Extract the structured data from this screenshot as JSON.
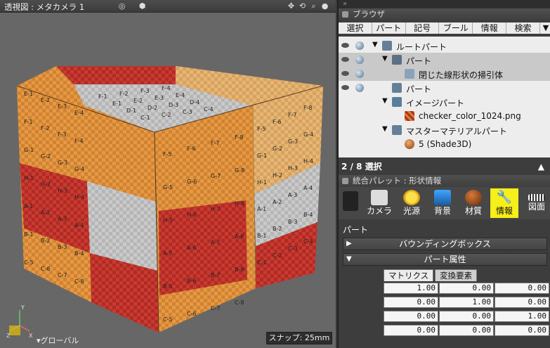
{
  "viewport": {
    "title": "透視図 : メタカメラ 1",
    "global_label": "グローバル",
    "snap_label": "スナップ: 25mm",
    "gizmo_labels": [
      "X",
      "Y",
      "Z"
    ]
  },
  "cube": {
    "top_labels": [
      "F-1",
      "F-2",
      "F-3",
      "F-4",
      "E-1",
      "E-2",
      "E-3",
      "E-4",
      "D-1",
      "D-2",
      "D-3",
      "D-4",
      "C-1",
      "C-2",
      "C-3",
      "C-4"
    ],
    "front_labels": [
      "F-5",
      "F-6",
      "F-7",
      "F-8",
      "G-5",
      "G-6",
      "G-7",
      "G-8",
      "H-5",
      "H-6",
      "H-7",
      "H-8",
      "A-5",
      "A-6",
      "A-7",
      "A-8",
      "B-5",
      "B-6",
      "B-7",
      "B-8",
      "C-5",
      "C-6",
      "C-7",
      "C-8"
    ],
    "right_labels": [
      "F-5",
      "F-6",
      "F-7",
      "F-8",
      "G-1",
      "G-2",
      "G-3",
      "G-4",
      "H-1",
      "H-2",
      "H-3",
      "H-4",
      "A-1",
      "A-2",
      "A-3",
      "A-4",
      "B-1",
      "B-2",
      "B-3",
      "B-4",
      "C-1",
      "C-2",
      "C-3",
      "C-4"
    ],
    "left_labels": [
      "E-1",
      "E-2",
      "E-3",
      "E-4",
      "F-1",
      "F-2",
      "F-3",
      "F-4",
      "G-1",
      "G-2",
      "G-3",
      "G-4",
      "H-1",
      "H-2",
      "H-3",
      "H-4",
      "A-1",
      "A-2",
      "A-3",
      "A-4",
      "B-1",
      "B-2",
      "B-3",
      "B-4",
      "C-5",
      "C-6",
      "C-7",
      "C-8"
    ],
    "colors": {
      "orange": "#d3822e",
      "red": "#b32a23",
      "gray": "#b8b8b8",
      "tan": "#d7a25e"
    }
  },
  "browser": {
    "header": "ブラウザ",
    "tabs": [
      "選択",
      "パート",
      "記号",
      "ブール",
      "情報",
      "検索",
      "▼"
    ],
    "tree": [
      {
        "label": "ルートパート",
        "icon": "part-icon"
      },
      {
        "label": "パート",
        "icon": "part-icon"
      },
      {
        "label": "閉じた線形状の掃引体",
        "icon": "sweep-icon"
      },
      {
        "label": "パート",
        "icon": "part-icon"
      },
      {
        "label": "イメージパート",
        "icon": "image-part-icon"
      },
      {
        "label": "checker_color_1024.png",
        "icon": "image-icon"
      },
      {
        "label": "マスターマテリアルパート",
        "icon": "material-part-icon"
      },
      {
        "label": "5 (Shade3D)",
        "icon": "material-icon"
      }
    ],
    "selection_count": "2 / 8 選択",
    "scroll_up": "▲"
  },
  "palette": {
    "header": "統合パレット : 形状情報",
    "tools": [
      "カメラ",
      "光源",
      "背景",
      "材質",
      "情報",
      "図面"
    ],
    "active_tool": "情報",
    "part_label": "パート",
    "sections": {
      "bbox": "バウンディングボックス",
      "attrs": "パート属性"
    },
    "matrix_tabs": [
      "マトリクス",
      "変換要素"
    ],
    "matrix": [
      [
        "1.00",
        "0.00",
        "0.00"
      ],
      [
        "0.00",
        "1.00",
        "0.00"
      ],
      [
        "0.00",
        "0.00",
        "1.00"
      ],
      [
        "0.00",
        "0.00",
        "0.00"
      ]
    ],
    "active_color": "#f6ef18"
  }
}
